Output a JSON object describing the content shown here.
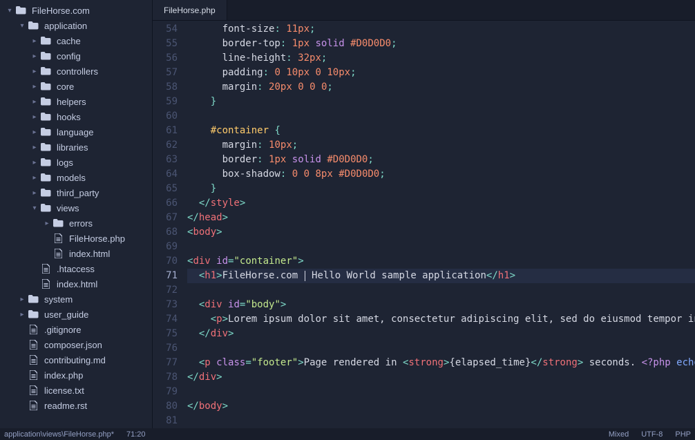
{
  "tab": {
    "title": "FileHorse.php"
  },
  "statusbar": {
    "path": "application\\views\\FileHorse.php*",
    "linecol": "71:20",
    "indent": "Mixed",
    "encoding": "UTF-8",
    "lang": "PHP"
  },
  "tree": [
    {
      "depth": 0,
      "arrow": "▾",
      "type": "folder",
      "label": "FileHorse.com"
    },
    {
      "depth": 1,
      "arrow": "▾",
      "type": "folder",
      "label": "application"
    },
    {
      "depth": 2,
      "arrow": "▸",
      "type": "folder",
      "label": "cache"
    },
    {
      "depth": 2,
      "arrow": "▸",
      "type": "folder",
      "label": "config"
    },
    {
      "depth": 2,
      "arrow": "▸",
      "type": "folder",
      "label": "controllers"
    },
    {
      "depth": 2,
      "arrow": "▸",
      "type": "folder",
      "label": "core"
    },
    {
      "depth": 2,
      "arrow": "▸",
      "type": "folder",
      "label": "helpers"
    },
    {
      "depth": 2,
      "arrow": "▸",
      "type": "folder",
      "label": "hooks"
    },
    {
      "depth": 2,
      "arrow": "▸",
      "type": "folder",
      "label": "language"
    },
    {
      "depth": 2,
      "arrow": "▸",
      "type": "folder",
      "label": "libraries"
    },
    {
      "depth": 2,
      "arrow": "▸",
      "type": "folder",
      "label": "logs"
    },
    {
      "depth": 2,
      "arrow": "▸",
      "type": "folder",
      "label": "models"
    },
    {
      "depth": 2,
      "arrow": "▸",
      "type": "folder",
      "label": "third_party"
    },
    {
      "depth": 2,
      "arrow": "▾",
      "type": "folder",
      "label": "views"
    },
    {
      "depth": 3,
      "arrow": "▸",
      "type": "folder",
      "label": "errors"
    },
    {
      "depth": 3,
      "arrow": "",
      "type": "file",
      "label": "FileHorse.php"
    },
    {
      "depth": 3,
      "arrow": "",
      "type": "file",
      "label": "index.html"
    },
    {
      "depth": 2,
      "arrow": "",
      "type": "file",
      "label": ".htaccess"
    },
    {
      "depth": 2,
      "arrow": "",
      "type": "file",
      "label": "index.html"
    },
    {
      "depth": 1,
      "arrow": "▸",
      "type": "folder",
      "label": "system"
    },
    {
      "depth": 1,
      "arrow": "▸",
      "type": "folder",
      "label": "user_guide"
    },
    {
      "depth": 1,
      "arrow": "",
      "type": "file",
      "label": ".gitignore"
    },
    {
      "depth": 1,
      "arrow": "",
      "type": "file",
      "label": "composer.json"
    },
    {
      "depth": 1,
      "arrow": "",
      "type": "file",
      "label": "contributing.md"
    },
    {
      "depth": 1,
      "arrow": "",
      "type": "file",
      "label": "index.php"
    },
    {
      "depth": 1,
      "arrow": "",
      "type": "file",
      "label": "license.txt"
    },
    {
      "depth": 1,
      "arrow": "",
      "type": "file",
      "label": "readme.rst"
    }
  ],
  "code": [
    {
      "n": 54,
      "html": "      <span class='tok-prop'>font-size</span><span class='tok-punc'>:</span> <span class='tok-num'>11px</span><span class='tok-punc'>;</span>"
    },
    {
      "n": 55,
      "html": "      <span class='tok-prop'>border-top</span><span class='tok-punc'>:</span> <span class='tok-num'>1px</span> <span class='tok-kw'>solid</span> <span class='tok-hex'>#D0D0D0</span><span class='tok-punc'>;</span>"
    },
    {
      "n": 56,
      "html": "      <span class='tok-prop'>line-height</span><span class='tok-punc'>:</span> <span class='tok-num'>32px</span><span class='tok-punc'>;</span>"
    },
    {
      "n": 57,
      "html": "      <span class='tok-prop'>padding</span><span class='tok-punc'>:</span> <span class='tok-num'>0</span> <span class='tok-num'>10px</span> <span class='tok-num'>0</span> <span class='tok-num'>10px</span><span class='tok-punc'>;</span>"
    },
    {
      "n": 58,
      "html": "      <span class='tok-prop'>margin</span><span class='tok-punc'>:</span> <span class='tok-num'>20px</span> <span class='tok-num'>0</span> <span class='tok-num'>0</span> <span class='tok-num'>0</span><span class='tok-punc'>;</span>"
    },
    {
      "n": 59,
      "html": "    <span class='tok-punc'>}</span>"
    },
    {
      "n": 60,
      "html": ""
    },
    {
      "n": 61,
      "html": "    <span class='tok-sel'>#container</span> <span class='tok-punc'>{</span>"
    },
    {
      "n": 62,
      "html": "      <span class='tok-prop'>margin</span><span class='tok-punc'>:</span> <span class='tok-num'>10px</span><span class='tok-punc'>;</span>"
    },
    {
      "n": 63,
      "html": "      <span class='tok-prop'>border</span><span class='tok-punc'>:</span> <span class='tok-num'>1px</span> <span class='tok-kw'>solid</span> <span class='tok-hex'>#D0D0D0</span><span class='tok-punc'>;</span>"
    },
    {
      "n": 64,
      "html": "      <span class='tok-prop'>box-shadow</span><span class='tok-punc'>:</span> <span class='tok-num'>0</span> <span class='tok-num'>0</span> <span class='tok-num'>8px</span> <span class='tok-hex'>#D0D0D0</span><span class='tok-punc'>;</span>"
    },
    {
      "n": 65,
      "html": "    <span class='tok-punc'>}</span>"
    },
    {
      "n": 66,
      "html": "  <span class='tok-punc'>&lt;/</span><span class='tok-tag'>style</span><span class='tok-punc'>&gt;</span>"
    },
    {
      "n": 67,
      "html": "<span class='tok-punc'>&lt;/</span><span class='tok-tag'>head</span><span class='tok-punc'>&gt;</span>"
    },
    {
      "n": 68,
      "html": "<span class='tok-punc'>&lt;</span><span class='tok-tag'>body</span><span class='tok-punc'>&gt;</span>"
    },
    {
      "n": 69,
      "html": ""
    },
    {
      "n": 70,
      "html": "<span class='tok-punc'>&lt;</span><span class='tok-tag'>div</span> <span class='tok-attr'>id</span><span class='tok-punc'>=</span><span class='tok-str'>&quot;container&quot;</span><span class='tok-punc'>&gt;</span>"
    },
    {
      "n": 71,
      "hl": true,
      "html": "  <span class='tok-punc'>&lt;</span><span class='tok-tag'>h1</span><span class='tok-punc'>&gt;</span>FileHorse.com <span class='cursor-bar'></span> Hello World sample application<span class='tok-punc'>&lt;/</span><span class='tok-tag'>h1</span><span class='tok-punc'>&gt;</span>"
    },
    {
      "n": 72,
      "html": ""
    },
    {
      "n": 73,
      "html": "  <span class='tok-punc'>&lt;</span><span class='tok-tag'>div</span> <span class='tok-attr'>id</span><span class='tok-punc'>=</span><span class='tok-str'>&quot;body&quot;</span><span class='tok-punc'>&gt;</span>"
    },
    {
      "n": 74,
      "html": "    <span class='tok-punc'>&lt;</span><span class='tok-tag'>p</span><span class='tok-punc'>&gt;</span>Lorem ipsum dolor sit amet, consectetur adipiscing elit, sed do eiusmod tempor incididun"
    },
    {
      "n": 75,
      "html": "  <span class='tok-punc'>&lt;/</span><span class='tok-tag'>div</span><span class='tok-punc'>&gt;</span>"
    },
    {
      "n": 76,
      "html": ""
    },
    {
      "n": 77,
      "html": "  <span class='tok-punc'>&lt;</span><span class='tok-tag'>p</span> <span class='tok-attr'>class</span><span class='tok-punc'>=</span><span class='tok-str'>&quot;footer&quot;</span><span class='tok-punc'>&gt;</span>Page rendered in <span class='tok-punc'>&lt;</span><span class='tok-tag'>strong</span><span class='tok-punc'>&gt;</span>{elapsed_time}<span class='tok-punc'>&lt;/</span><span class='tok-tag'>strong</span><span class='tok-punc'>&gt;</span> seconds. <span class='tok-php'>&lt;?php</span> <span class='tok-echo'>echo</span>  (ENVI"
    },
    {
      "n": 78,
      "html": "<span class='tok-punc'>&lt;/</span><span class='tok-tag'>div</span><span class='tok-punc'>&gt;</span>"
    },
    {
      "n": 79,
      "html": ""
    },
    {
      "n": 80,
      "html": "<span class='tok-punc'>&lt;/</span><span class='tok-tag'>body</span><span class='tok-punc'>&gt;</span>"
    },
    {
      "n": 81,
      "html": ""
    }
  ]
}
